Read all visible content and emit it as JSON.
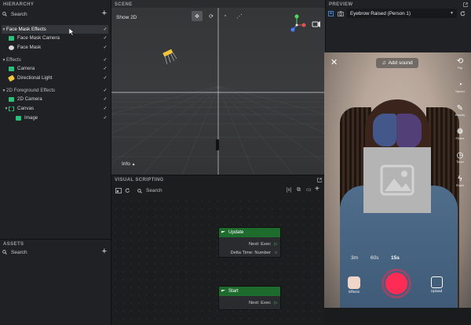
{
  "hierarchy": {
    "title": "HIERARCHY",
    "search_placeholder": "Search",
    "items": [
      {
        "label": "Face Mask Effects",
        "kind": "group-header"
      },
      {
        "label": "Face Mask Camera",
        "kind": "camera"
      },
      {
        "label": "Face Mask",
        "kind": "mask"
      },
      {
        "label": "Effects",
        "kind": "group-header"
      },
      {
        "label": "Camera",
        "kind": "camera"
      },
      {
        "label": "Directional Light",
        "kind": "light"
      },
      {
        "label": "2D Foreground Effects",
        "kind": "group-header"
      },
      {
        "label": "2D Camera",
        "kind": "camera"
      },
      {
        "label": "Canvas",
        "kind": "canvas"
      },
      {
        "label": "Image",
        "kind": "image"
      }
    ]
  },
  "assets": {
    "title": "ASSETS",
    "search_placeholder": "Search"
  },
  "scene": {
    "title": "SCENE",
    "mode_label": "Show 2D",
    "info_label": "Info"
  },
  "vscript": {
    "title": "VISUAL SCRIPTING",
    "search_placeholder": "Search",
    "nodes": [
      {
        "title": "Update",
        "ports": [
          {
            "label": "Next: Exec"
          },
          {
            "label": "Delta Time: Number"
          }
        ]
      },
      {
        "title": "Start",
        "ports": [
          {
            "label": "Next: Exec"
          }
        ]
      }
    ]
  },
  "preview": {
    "title": "PREVIEW",
    "selection": "Eyebrow Raised (Person 1)",
    "add_sound": "Add sound",
    "side_buttons": [
      "Flip",
      "Speed",
      "Beauty",
      "Filters",
      "Timer",
      "Flash"
    ],
    "durations": [
      "3m",
      "60s",
      "15s"
    ],
    "effects_label": "Effects",
    "upload_label": "Upload"
  },
  "colors": {
    "node_header": "#1e6b2e",
    "record": "#fe2c55",
    "axis_x": "#e05252",
    "axis_y": "#4cd964",
    "axis_z": "#4a7dff"
  }
}
